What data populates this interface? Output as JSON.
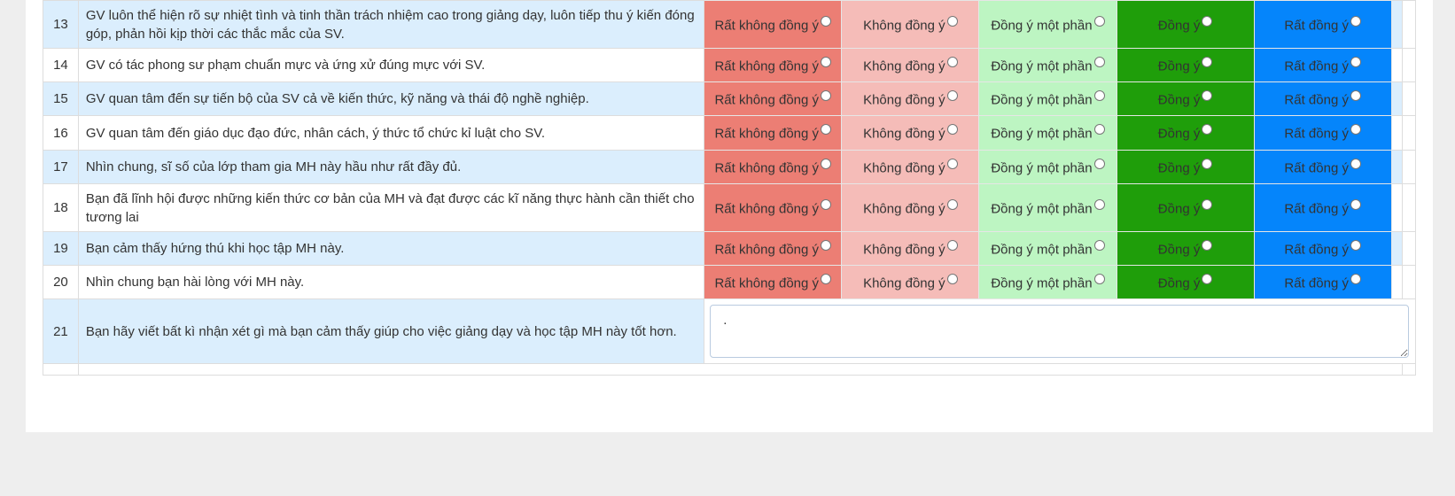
{
  "survey": {
    "options": [
      "Rất không đồng ý",
      "Không đồng ý",
      "Đồng ý một phần",
      "Đồng ý",
      "Rất đồng ý"
    ],
    "rows": [
      {
        "num": "13",
        "text": "GV luôn thể hiện rõ sự nhiệt tình và tinh thần trách nhiệm cao trong giảng dạy, luôn tiếp thu ý kiến đóng góp, phản hồi kịp thời các thắc mắc của SV."
      },
      {
        "num": "14",
        "text": "GV có tác phong sư phạm chuẩn mực và ứng xử đúng mực với SV."
      },
      {
        "num": "15",
        "text": "GV quan tâm đến sự tiến bộ của SV cả về kiến thức, kỹ năng và thái độ nghề nghiệp."
      },
      {
        "num": "16",
        "text": "GV quan tâm đến giáo dục đạo đức, nhân cách, ý thức tổ chức kỉ luật cho SV."
      },
      {
        "num": "17",
        "text": "Nhìn chung, sĩ số của lớp tham gia MH này hầu như rất đầy đủ."
      },
      {
        "num": "18",
        "text": "Bạn đã lĩnh hội được những kiến thức cơ bản của MH và đạt được các kĩ năng thực hành cần thiết cho tương lai"
      },
      {
        "num": "19",
        "text": "Bạn cảm thấy hứng thú khi học tập MH này."
      },
      {
        "num": "20",
        "text": "Nhìn chung bạn hài lòng với MH này."
      }
    ],
    "comment_row": {
      "num": "21",
      "text": "Bạn hãy viết bất kì nhận xét gì mà bạn cảm thấy giúp cho việc giảng dạy và học tập MH này tốt hơn.",
      "value": "."
    }
  },
  "colors": {
    "strongly_disagree": "#ec7e74",
    "disagree": "#f5bcb8",
    "partly_agree": "#bdf5c2",
    "agree": "#1f9e0a",
    "strongly_agree": "#0585fb",
    "row_highlight": "#dbeefd"
  }
}
